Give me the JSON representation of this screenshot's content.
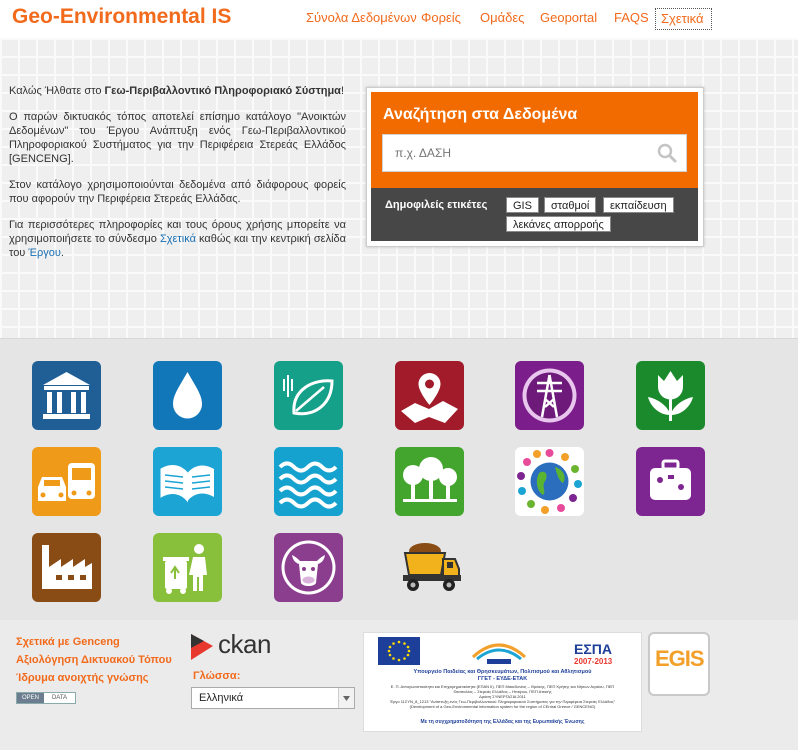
{
  "header": {
    "logo": "Geo-Environmental IS",
    "nav": [
      {
        "label": "Σύνολα Δεδομένων"
      },
      {
        "label": "Φορείς"
      },
      {
        "label": "Ομάδες"
      },
      {
        "label": "Geoportal"
      },
      {
        "label": "FAQS"
      },
      {
        "label": "Σχετικά"
      }
    ]
  },
  "intro": {
    "p1_a": "Καλώς Ήλθατε στο ",
    "p1_b": "Γεω-Περιβαλλοντικό Πληροφοριακό Σύστημα",
    "p1_c": "!",
    "p2": "Ο παρών δικτυακός τόπος αποτελεί επίσημο κατάλογο \"Ανοικτών Δεδομένων\" του Έργου Ανάπτυξη ενός Γεω-Περιβαλλοντικού Πληροφοριακού Συστήματος για την Περιφέρεια Στερεάς Ελλάδος [GENCENG].",
    "p3": "Στον κατάλογο χρησιμοποιούνται δεδομένα από διάφορους φορείς που αφορούν την Περιφέρεια Στερεάς Ελλάδας.",
    "p4_a": "Για περισσότερες πληροφορίες και τους όρους χρήσης μπορείτε να χρησιμοποιήσετε το σύνδεσμο ",
    "p4_link1": "Σχετικά",
    "p4_b": " καθώς και την κεντρική σελίδα του ",
    "p4_link2": "Έργου",
    "p4_c": "."
  },
  "search": {
    "title": "Αναζήτηση στα Δεδομένα",
    "placeholder": "π.χ. ΔΑΣΗ",
    "tags_label": "Δημοφιλείς ετικέτες",
    "tags": [
      {
        "label": "GIS"
      },
      {
        "label": "σταθμοί"
      },
      {
        "label": "εκπαίδευση"
      },
      {
        "label": "λεκάνες απορροής"
      }
    ]
  },
  "categories": [
    {
      "icon": "government-building-icon",
      "color": "#1f5f96"
    },
    {
      "icon": "water-drop-icon",
      "color": "#1277b9"
    },
    {
      "icon": "leaf-icon",
      "color": "#15a089"
    },
    {
      "icon": "map-pin-icon",
      "color": "#a11b2a"
    },
    {
      "icon": "power-tower-icon",
      "color": "#7b1d8a"
    },
    {
      "icon": "tulip-flower-icon",
      "color": "#1a8a2c"
    },
    {
      "icon": "traffic-vehicles-icon",
      "color": "#f09a1a"
    },
    {
      "icon": "open-book-icon",
      "color": "#1ba4d4"
    },
    {
      "icon": "waves-icon",
      "color": "#16a2cf"
    },
    {
      "icon": "trees-icon",
      "color": "#43a42e"
    },
    {
      "icon": "globe-people-icon",
      "color": "#cf4c9b"
    },
    {
      "icon": "suitcase-icon",
      "color": "#7d2590"
    },
    {
      "icon": "factory-icon",
      "color": "#8a4c15"
    },
    {
      "icon": "recycling-bin-icon",
      "color": "#88bf3b"
    },
    {
      "icon": "cow-icon",
      "color": "#8b3d8e"
    },
    {
      "icon": "dump-truck-icon",
      "color": "#e5e5e5"
    }
  ],
  "footer": {
    "links": [
      {
        "label": "Σχετικά με Genceng"
      },
      {
        "label": "Αξιολόγηση Δικτυακού Τόπου"
      },
      {
        "label": "Ίδρυμα ανοιχτής γνώσης"
      }
    ],
    "badge_left": "OPEN",
    "badge_right": "DATA",
    "ckan": "ckan",
    "language_label": "Γλώσσα:",
    "language_value": "Ελληνικά",
    "banner": {
      "espa": "ΕΣΠΑ",
      "espa_years": "2007-2013",
      "ministry": "Υπουργείο Παιδείας και Θρησκευμάτων, Πολιτισμού και Αθλητισμού",
      "agency": "ΓΓΕΤ - ΕΥΔΕ-ΕΤΑΚ",
      "line1": "Ε. Π. Ανταγωνιστικότητα και Επιχειρηματικότητα (ΕΠΑΝ ΙΙ), ΠΕΠ Μακεδονίας – Θράκης, ΠΕΠ Κρήτης και Νήσων Αιγαίου, ΠΕΠ",
      "line2": "Θεσσαλίας – Στερεάς Ελλάδας – Ηπείρου, ΠΕΠ Αττικής",
      "line3": "Δράση ΣΥΝΕΡΓΑΣΙΑ 2011",
      "line4": "Έργο 11ΣΥΝ_8_1213 \"Ανάπτυξη ενός Γεω-Περιβαλλοντικού Πληροφοριακού Συστήματος για την Περιφέρεια Στερεάς Ελλάδας\"",
      "line5": "(Development of a Geo-Environmental information system for the region of CEntral Greece / GENCENG)",
      "cofund": "Με τη συγχρηματοδότηση της Ελλάδας και της Ευρωπαϊκής Ένωσης"
    },
    "egis": "EGIS"
  }
}
